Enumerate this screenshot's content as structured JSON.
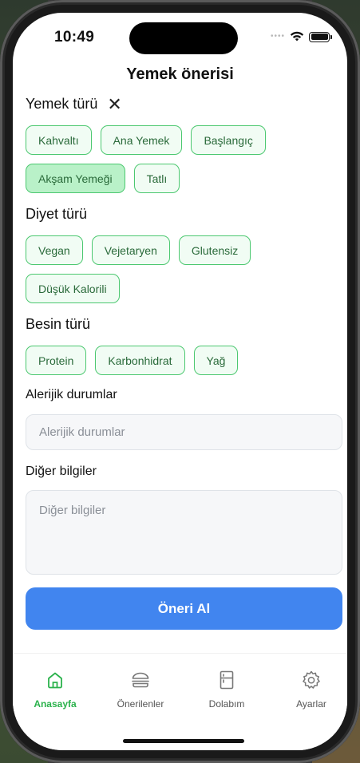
{
  "status": {
    "time": "10:49"
  },
  "header": {
    "title": "Yemek önerisi"
  },
  "meal_type": {
    "title": "Yemek türü",
    "clear_icon": "close-icon",
    "options": [
      "Kahvaltı",
      "Ana Yemek",
      "Başlangıç",
      "Akşam Yemeği",
      "Tatlı"
    ],
    "selected": "Akşam Yemeği"
  },
  "diet_type": {
    "title": "Diyet türü",
    "options": [
      "Vegan",
      "Vejetaryen",
      "Glutensiz",
      "Düşük Kalorili"
    ]
  },
  "nutrient_type": {
    "title": "Besin türü",
    "options": [
      "Protein",
      "Karbonhidrat",
      "Yağ"
    ]
  },
  "allergies": {
    "label": "Alerijik durumlar",
    "placeholder": "Alerijik durumlar"
  },
  "other_info": {
    "label": "Diğer bilgiler",
    "placeholder": "Diğer bilgiler"
  },
  "submit": {
    "label": "Öneri Al"
  },
  "tabs": [
    {
      "label": "Anasayfa",
      "icon": "home-icon",
      "active": true
    },
    {
      "label": "Önerilenler",
      "icon": "burger-icon",
      "active": false
    },
    {
      "label": "Dolabım",
      "icon": "fridge-icon",
      "active": false
    },
    {
      "label": "Ayarlar",
      "icon": "gear-icon",
      "active": false
    }
  ],
  "colors": {
    "accent": "#4185ef",
    "chip_border": "#4cc870",
    "chip_selected": "#b9f1c8",
    "tab_active": "#2bb24c"
  }
}
